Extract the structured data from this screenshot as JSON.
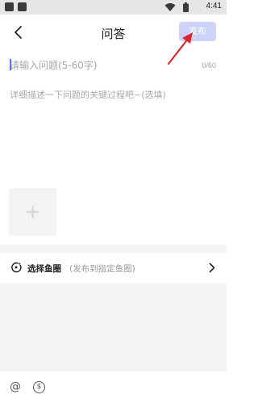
{
  "status_bar": {
    "time": "4:41",
    "icons": [
      "notification-icon",
      "notification-icon",
      "wifi-icon",
      "battery-icon"
    ]
  },
  "header": {
    "title": "问答",
    "publish_label": "发布",
    "publish_color": "#cdd3f7"
  },
  "form": {
    "title_placeholder": "请输入问题(5-60字)",
    "title_counter": "0/60",
    "description_placeholder": "详细描述一下问题的关键过程吧~(选填)"
  },
  "circle": {
    "label": "选择鱼圈",
    "hint": "(发布到指定鱼圈)"
  },
  "toolbar": {
    "mention_glyph": "@",
    "money_glyph": "$"
  },
  "annotation_color": "#d9272e",
  "accent_color": "#5470ff"
}
